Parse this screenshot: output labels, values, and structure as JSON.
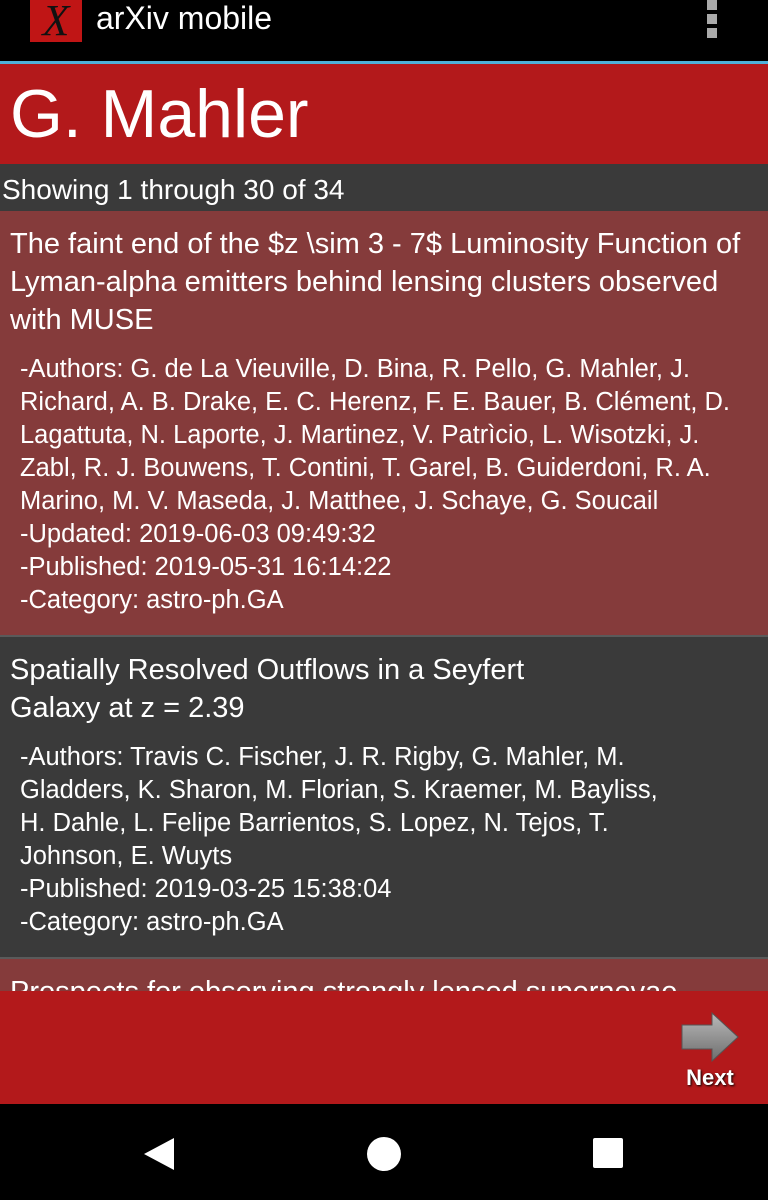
{
  "appbar": {
    "logo": "X",
    "title": "arXiv mobile"
  },
  "header": {
    "title": "G. Mahler"
  },
  "results": {
    "count_text": "Showing 1 through 30 of 34"
  },
  "papers": [
    {
      "title": "The faint end of the $z \\sim 3 - 7$ Luminosity Function of Lyman-alpha emitters behind lensing clusters observed with MUSE",
      "authors": "-Authors: G. de La Vieuville, D. Bina, R. Pello, G. Mahler, J. Richard, A. B. Drake, E. C. Herenz, F. E. Bauer, B. Clément, D. Lagattuta, N. Laporte, J. Martinez, V. Patrìcio, L. Wisotzki, J. Zabl, R. J. Bouwens, T. Contini, T. Garel, B. Guiderdoni, R. A. Marino, M. V. Maseda, J. Matthee, J. Schaye, G. Soucail",
      "updated": "-Updated: 2019-06-03 09:49:32",
      "published": "-Published: 2019-05-31 16:14:22",
      "category": "-Category: astro-ph.GA"
    },
    {
      "title": "Spatially Resolved Outflows in a Seyfert Galaxy at z = 2.39",
      "authors": "-Authors: Travis C. Fischer, J. R. Rigby, G. Mahler, M. Gladders, K. Sharon, M. Florian, S. Kraemer, M. Bayliss, H. Dahle, L. Felipe Barrientos, S. Lopez, N. Tejos, T. Johnson, E. Wuyts",
      "published": "-Published: 2019-03-25 15:38:04",
      "category": "-Category: astro-ph.GA"
    },
    {
      "title": "Prospects for observing strongly lensed supernovae"
    }
  ],
  "bottombar": {
    "next_label": "Next"
  },
  "icons": {
    "menu": "overflow-menu-icon",
    "next": "arrow-right-icon",
    "back": "back-icon",
    "home": "home-icon",
    "recent": "recent-apps-icon"
  },
  "colors": {
    "brand": "#b3191b",
    "highlight_row": "#853b3b",
    "accent_line": "#4fb0d9"
  }
}
